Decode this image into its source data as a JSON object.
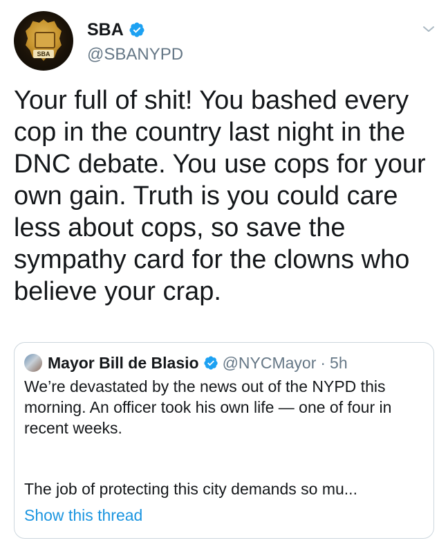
{
  "author": {
    "display_name": "SBA",
    "handle": "@SBANYPD",
    "verified": true,
    "avatar_badge_text": "SBA",
    "avatar_icon": "police-badge"
  },
  "menu_icon": "chevron-down-icon",
  "tweet": {
    "text": "Your full of shit! You bashed every cop in the country last night in the DNC debate. You use cops for your own gain. Truth is you could care less about cops, so save the sympathy card for the clowns who believe your crap."
  },
  "quoted_tweet": {
    "display_name": "Mayor Bill de Blasio",
    "handle": "@NYCMayor",
    "separator": "·",
    "time": "5h",
    "verified": true,
    "paragraph_1": "We’re devastated by the news out of the NYPD this morning. An officer took his own life — one of four in recent weeks.",
    "paragraph_2": "The job of protecting this city demands so mu...",
    "show_thread_label": "Show this thread"
  },
  "colors": {
    "verified_blue": "#1da1f2",
    "link_blue": "#1b95e0",
    "secondary_text": "#657786",
    "border": "#ccd6dd"
  }
}
